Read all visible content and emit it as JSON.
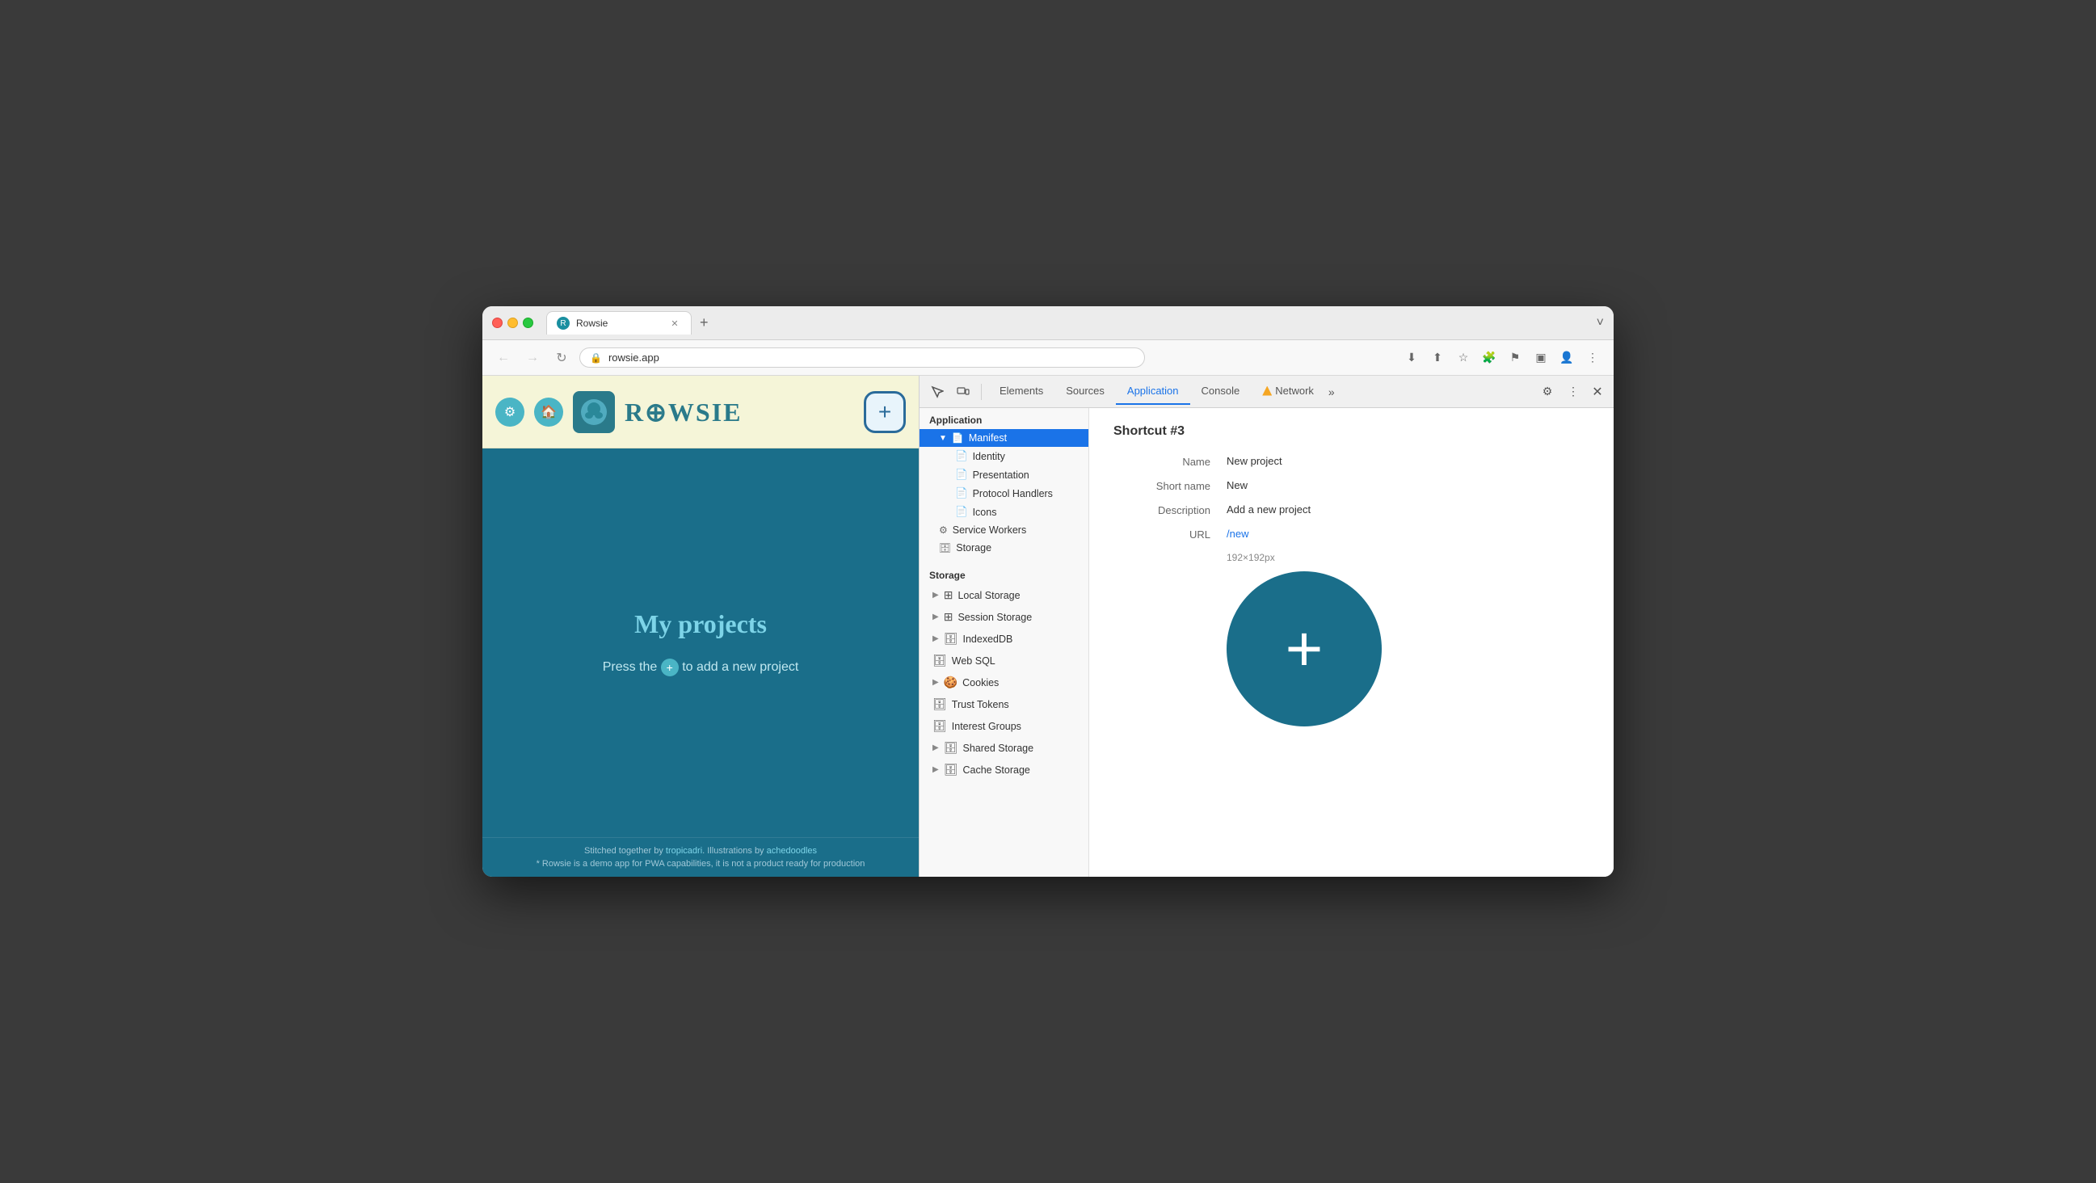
{
  "browser": {
    "tab_title": "Rowsie",
    "url": "rowsie.app",
    "new_tab_label": "+"
  },
  "website": {
    "title": "My projects",
    "subtitle_prefix": "Press the",
    "subtitle_suffix": "to add a new project",
    "footer_line1_prefix": "Stitched together by ",
    "footer_link1": "tropicadri",
    "footer_line1_middle": ". Illustrations by ",
    "footer_link2": "achedoodles",
    "footer_line2": "* Rowsie is a demo app for PWA capabilities, it is not a product ready for production",
    "logo_text": "R◠WSIE",
    "nav_icons": [
      "⚙",
      "🏠"
    ]
  },
  "devtools": {
    "toolbar": {
      "tabs": [
        "Elements",
        "Sources",
        "Application",
        "Console",
        "Network"
      ],
      "active_tab": "Application",
      "overflow": "»",
      "warning_tab": "Network",
      "settings_label": "⚙",
      "more_label": "⋮",
      "close_label": "✕",
      "cursor_icon": "⬚",
      "sidebar_icon": "▣"
    },
    "sidebar": {
      "application_header": "Application",
      "manifest_label": "Manifest",
      "manifest_children": [
        "Identity",
        "Presentation",
        "Protocol Handlers",
        "Icons"
      ],
      "service_workers_label": "Service Workers",
      "storage_label": "Storage",
      "storage_section_header": "Storage",
      "storage_items": [
        {
          "label": "Local Storage",
          "expandable": true
        },
        {
          "label": "Session Storage",
          "expandable": true
        },
        {
          "label": "IndexedDB",
          "expandable": true
        },
        {
          "label": "Web SQL",
          "expandable": false
        },
        {
          "label": "Cookies",
          "expandable": true
        },
        {
          "label": "Trust Tokens",
          "expandable": false
        },
        {
          "label": "Interest Groups",
          "expandable": false
        },
        {
          "label": "Shared Storage",
          "expandable": true
        },
        {
          "label": "Cache Storage",
          "expandable": true
        }
      ]
    },
    "main": {
      "shortcut_heading": "Shortcut #3",
      "fields": [
        {
          "label": "Name",
          "value": "New project",
          "type": "text"
        },
        {
          "label": "Short name",
          "value": "New",
          "type": "text"
        },
        {
          "label": "Description",
          "value": "Add a new project",
          "type": "text"
        },
        {
          "label": "URL",
          "value": "/new",
          "type": "link"
        }
      ],
      "icon_size": "192×192px",
      "icon_color": "#1a6e8a"
    }
  }
}
